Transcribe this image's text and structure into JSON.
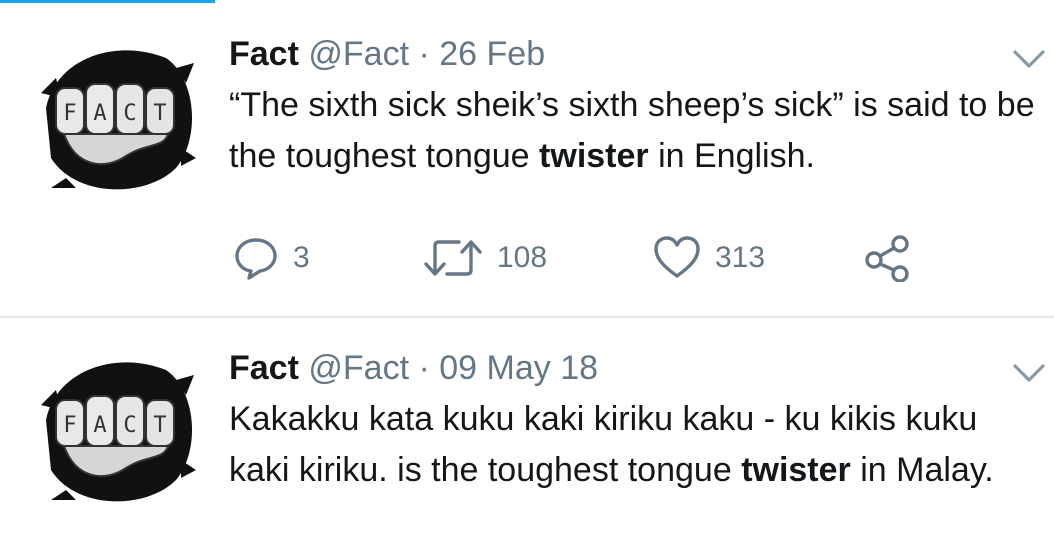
{
  "tweets": [
    {
      "display_name": "Fact",
      "handle": "@Fact",
      "separator": "·",
      "date": "26 Feb",
      "avatar_text": [
        "F",
        "A",
        "C",
        "T"
      ],
      "text_before": "“The sixth sick sheik’s sixth sheep’s sick” is said to be the toughest tongue ",
      "text_bold": "twister",
      "text_after": " in English.",
      "replies": "3",
      "retweets": "108",
      "likes": "313"
    },
    {
      "display_name": "Fact",
      "handle": "@Fact",
      "separator": "·",
      "date": "09 May 18",
      "avatar_text": [
        "F",
        "A",
        "C",
        "T"
      ],
      "text_before": "Kakakku kata kuku kaki kiriku kaku - ku kikis kuku kaki kiriku. is the toughest tongue ",
      "text_bold": "twister",
      "text_after": " in Malay."
    }
  ],
  "colors": {
    "accent": "#1da1f2",
    "text": "#14171a",
    "secondary": "#657786",
    "divider": "#e1e8ed"
  },
  "icons": [
    "reply-icon",
    "retweet-icon",
    "like-icon",
    "share-icon",
    "chevron-down-icon"
  ]
}
